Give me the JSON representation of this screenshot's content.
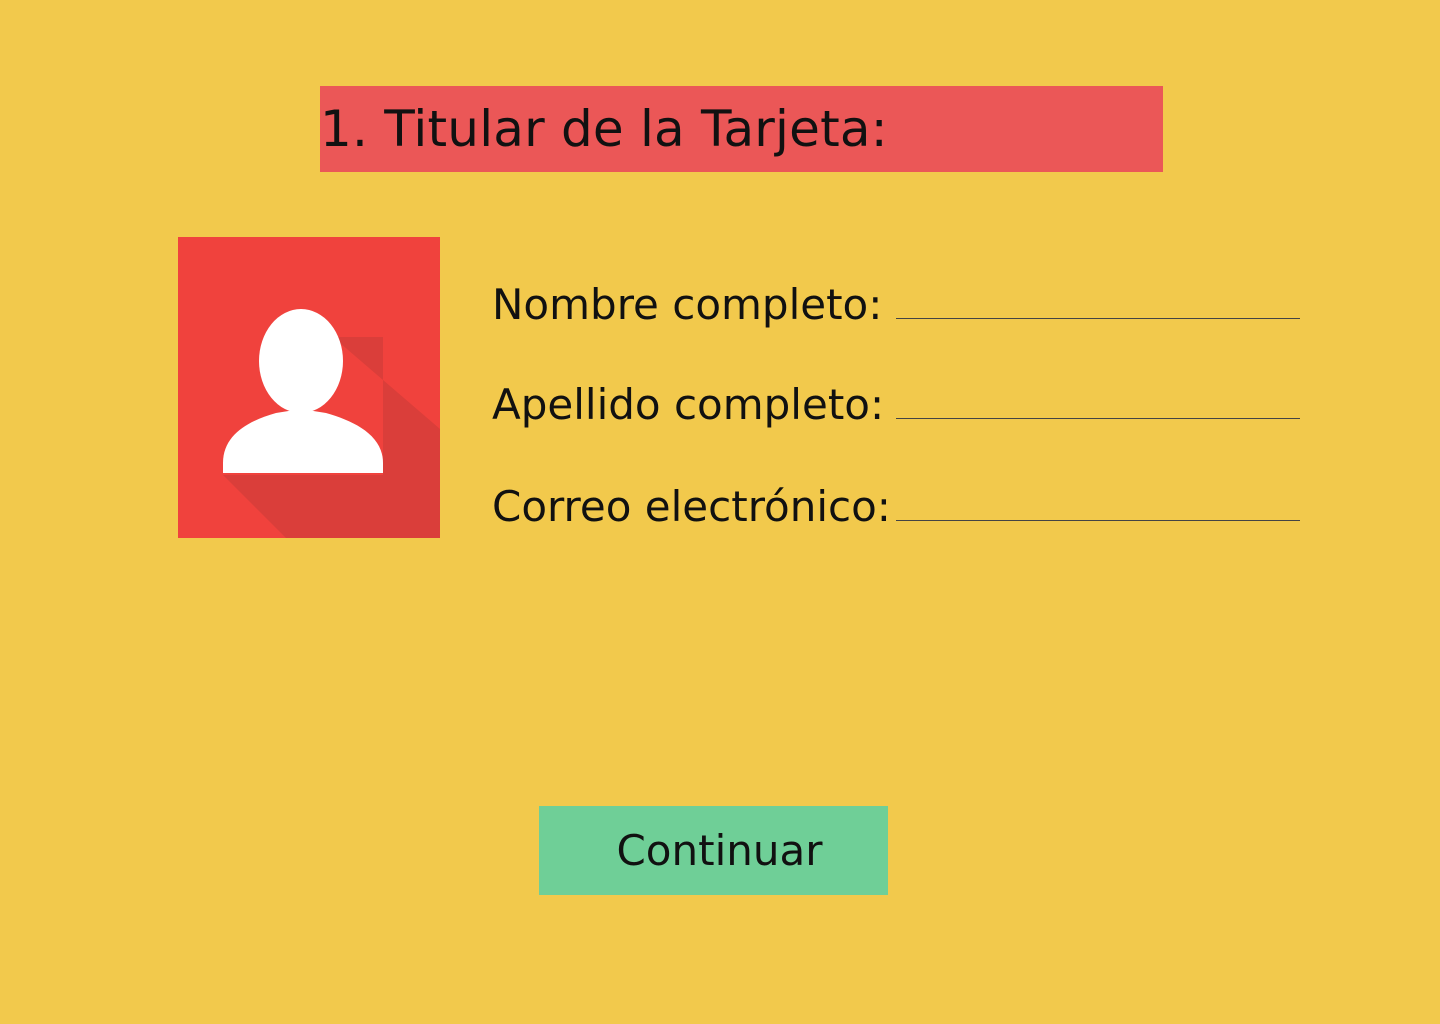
{
  "header": {
    "title": "1. Titular de la Tarjeta:"
  },
  "avatar": {
    "icon": "user-silhouette-icon"
  },
  "form": {
    "fields": [
      {
        "label": "Nombre completo:",
        "value": ""
      },
      {
        "label": "Apellido completo:",
        "value": ""
      },
      {
        "label": "Correo electrónico:",
        "value": ""
      }
    ]
  },
  "actions": {
    "continue_label": "Continuar"
  },
  "colors": {
    "background": "#F2C94C",
    "title_bar": "#EB5757",
    "avatar_bg": "#F0423D",
    "avatar_shadow": "#DA3E3A",
    "button": "#6FCF97"
  }
}
